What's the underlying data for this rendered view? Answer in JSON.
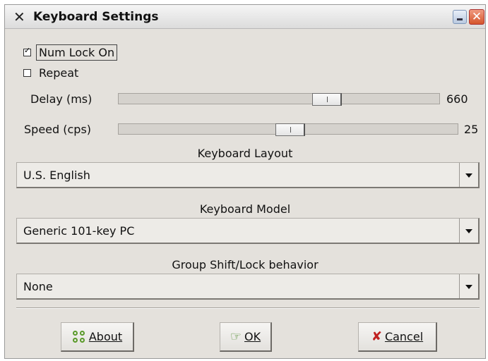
{
  "window": {
    "title": "Keyboard Settings",
    "close_glyph": "X"
  },
  "options": {
    "num_lock_label": "Num Lock On",
    "num_lock_checked": true,
    "repeat_label": "Repeat",
    "repeat_checked": false
  },
  "delay": {
    "label": "Delay (ms)",
    "value": "660"
  },
  "speed": {
    "label": "Speed (cps)",
    "value": "25"
  },
  "layout": {
    "label": "Keyboard Layout",
    "selected": "U.S. English"
  },
  "model": {
    "label": "Keyboard Model",
    "selected": "Generic 101-key PC"
  },
  "group_shift": {
    "label": "Group Shift/Lock behavior",
    "selected": "None"
  },
  "buttons": {
    "about_label": "About",
    "ok_label": "OK",
    "cancel_label": "Cancel"
  },
  "icons": {
    "window_icon": "x-logo-icon",
    "minimize": "minimize-icon",
    "close": "close-icon",
    "about": "about-icon",
    "ok": "ok-hand-icon",
    "cancel": "cancel-x-icon"
  }
}
